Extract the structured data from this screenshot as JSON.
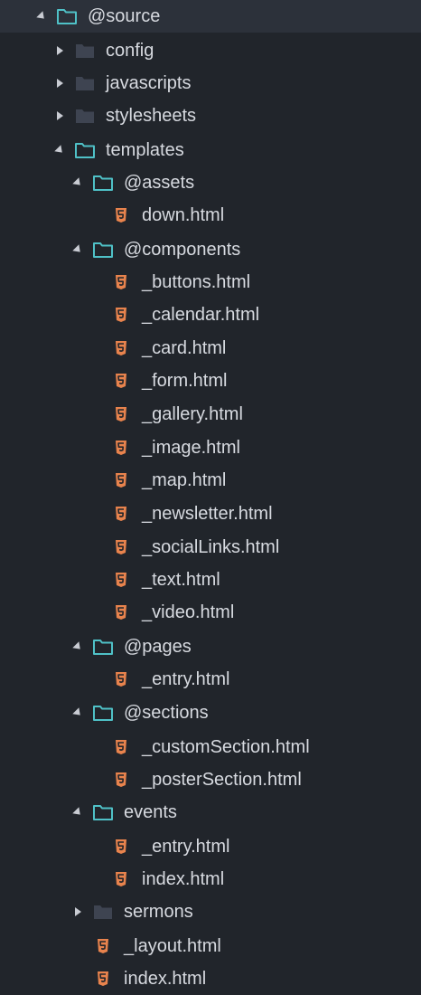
{
  "colors": {
    "background": "#21252b",
    "selected_row": "#2c313a",
    "text": "#d7dae0",
    "folder_open": "#4fc1c7",
    "folder_closed": "#3e4451",
    "html_icon": "#e8834d"
  },
  "tree": [
    {
      "label": "@source",
      "kind": "folder-open",
      "expanded": true,
      "depth": 0
    },
    {
      "label": "config",
      "kind": "folder-closed",
      "expanded": false,
      "depth": 1
    },
    {
      "label": "javascripts",
      "kind": "folder-closed",
      "expanded": false,
      "depth": 1
    },
    {
      "label": "stylesheets",
      "kind": "folder-closed",
      "expanded": false,
      "depth": 1
    },
    {
      "label": "templates",
      "kind": "folder-open",
      "expanded": true,
      "depth": 1
    },
    {
      "label": "@assets",
      "kind": "folder-open",
      "expanded": true,
      "depth": 2
    },
    {
      "label": "down.html",
      "kind": "html",
      "depth": 3
    },
    {
      "label": "@components",
      "kind": "folder-open",
      "expanded": true,
      "depth": 2
    },
    {
      "label": "_buttons.html",
      "kind": "html",
      "depth": 3
    },
    {
      "label": "_calendar.html",
      "kind": "html",
      "depth": 3
    },
    {
      "label": "_card.html",
      "kind": "html",
      "depth": 3
    },
    {
      "label": "_form.html",
      "kind": "html",
      "depth": 3
    },
    {
      "label": "_gallery.html",
      "kind": "html",
      "depth": 3
    },
    {
      "label": "_image.html",
      "kind": "html",
      "depth": 3
    },
    {
      "label": "_map.html",
      "kind": "html",
      "depth": 3
    },
    {
      "label": "_newsletter.html",
      "kind": "html",
      "depth": 3
    },
    {
      "label": "_socialLinks.html",
      "kind": "html",
      "depth": 3
    },
    {
      "label": "_text.html",
      "kind": "html",
      "depth": 3
    },
    {
      "label": "_video.html",
      "kind": "html",
      "depth": 3
    },
    {
      "label": "@pages",
      "kind": "folder-open",
      "expanded": true,
      "depth": 2
    },
    {
      "label": "_entry.html",
      "kind": "html",
      "depth": 3
    },
    {
      "label": "@sections",
      "kind": "folder-open",
      "expanded": true,
      "depth": 2
    },
    {
      "label": "_customSection.html",
      "kind": "html",
      "depth": 3
    },
    {
      "label": "_posterSection.html",
      "kind": "html",
      "depth": 3
    },
    {
      "label": "events",
      "kind": "folder-open",
      "expanded": true,
      "depth": 2
    },
    {
      "label": "_entry.html",
      "kind": "html",
      "depth": 3
    },
    {
      "label": "index.html",
      "kind": "html",
      "depth": 3
    },
    {
      "label": "sermons",
      "kind": "folder-closed",
      "expanded": false,
      "depth": 2
    },
    {
      "label": "_layout.html",
      "kind": "html",
      "depth": 2
    },
    {
      "label": "index.html",
      "kind": "html",
      "depth": 2
    }
  ]
}
